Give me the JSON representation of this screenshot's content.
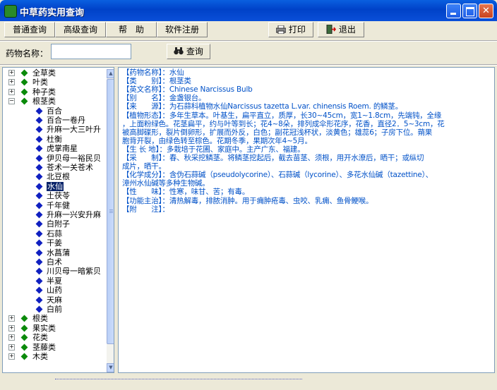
{
  "window": {
    "title": "中草药实用查询"
  },
  "toolbar": {
    "normal_query": "普通查询",
    "advanced_query": "高级查询",
    "help": "帮　助",
    "register": "软件注册",
    "print": "打印",
    "exit": "退出"
  },
  "search": {
    "label": "药物名称：",
    "value": "",
    "button": "查询"
  },
  "tree": {
    "categories_top": [
      "全草类",
      "叶类",
      "种子类",
      "根茎类"
    ],
    "children": [
      "百合",
      "百合一卷丹",
      "升麻一大三叶升",
      "杜衡",
      "虎掌南星",
      "伊贝母一裕民贝",
      "苍术一关苍术",
      "北豆根",
      "水仙",
      "土茯苓",
      "千年健",
      "升麻一兴安升麻",
      "白附子",
      "石蒜",
      "干姜",
      "水菖蒲",
      "白术",
      "川贝母一暗紫贝",
      "半夏",
      "山药",
      "天麻",
      "白前"
    ],
    "selected": "水仙",
    "categories_bottom": [
      "根类",
      "果实类",
      "花类",
      "茎藤类",
      "木类"
    ]
  },
  "detail": {
    "lines": [
      "【药物名称】：水仙",
      "【类　　别】：根茎类",
      "【英文名称】：Chinese Narcissus Bulb",
      "【别　　名】：金盏银台。",
      "【来　　源】：为石蒜科植物水仙Narcissus tazetta L.var. chinensis Roem. 的鳞茎。",
      "【植物形态】：多年生草本。叶基生，扁平直立，质厚，长30~45cm，宽1~1.8cm，先端钝，全缘",
      "，上面粉绿色。花茎扁平，约与叶等到长；花4~8朵，排列成伞形花序，花香，直径2．5~3cm，花",
      "被高脚碟形，裂片倒卵形，扩展而外反，白色；副花冠浅杯状，淡黄色；雄蕊6；子房下位。蒴果",
      "胞背开裂，由绿色转至棕色。花期冬季，果期次年4~5月。",
      "【生 长 地】：多栽培于花圃、家庭中。主产广东、福建。",
      "【采　　制】：春、秋采挖鳞茎。将鳞茎挖起后，截去苗茎、须根，用开水潦后，晒干；或纵切",
      "成片，晒干。",
      "【化学成分】：含伪石蒜碱（pseudolycorine）、石蒜碱（lycorine）、多花水仙碱（tazettine）、",
      "漳州水仙碱等多种生物碱。",
      "【性　　味】：性寒，味甘、苦；有毒。",
      "【功能主治】：清热解毒，排脓消肿。用于痈肿疮毒、虫咬、乳痈、鱼骨鲠喉。",
      "【附　　注】："
    ]
  },
  "colors": {
    "title_bar": "#0A4FD8",
    "detail_text": "#0051C8",
    "selection": "#0A246A",
    "category_icon": "#0A8A0A",
    "herb_icon": "#1020C0"
  },
  "icons": [
    "app-icon",
    "printer-icon",
    "exit-icon",
    "binoculars-icon",
    "minimize-icon",
    "maximize-icon",
    "close-icon"
  ]
}
